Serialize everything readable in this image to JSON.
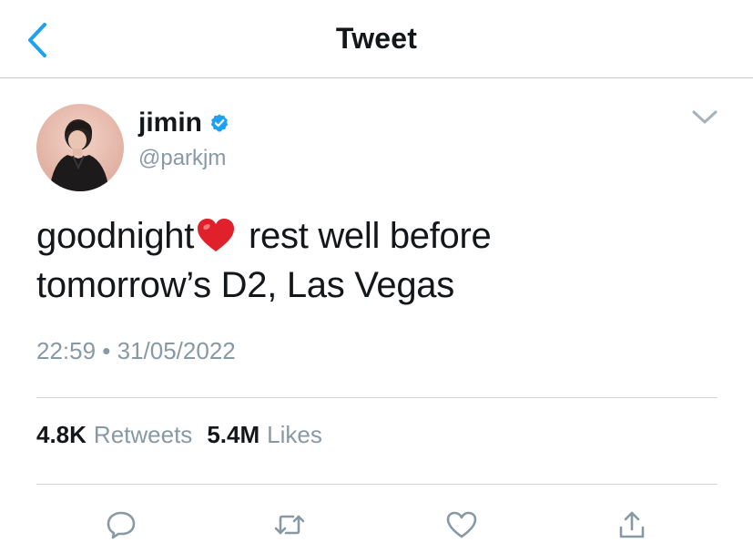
{
  "header": {
    "title": "Tweet"
  },
  "author": {
    "name": "jimin",
    "handle": "@parkjm",
    "verified": true
  },
  "tweet": {
    "text_line1_before_emoji": "goodnight",
    "emoji": "heart",
    "text_line1_after_emoji": "rest well before",
    "text_line2": "tomorrow’s D2, Las Vegas",
    "timestamp": "22:59 • 31/05/2022"
  },
  "stats": {
    "retweets_count": "4.8K",
    "retweets_label": "Retweets",
    "likes_count": "5.4M",
    "likes_label": "Likes"
  },
  "icons": {
    "back": "chevron-left-icon",
    "caret": "chevron-down-icon",
    "verified": "verified-badge-icon",
    "reply": "reply-icon",
    "retweet": "retweet-icon",
    "like": "heart-outline-icon",
    "share": "share-icon"
  },
  "colors": {
    "accent": "#1da1f2",
    "secondary_text": "#8899a6",
    "primary_text": "#14171a",
    "heart_emoji": "#e0202a"
  }
}
